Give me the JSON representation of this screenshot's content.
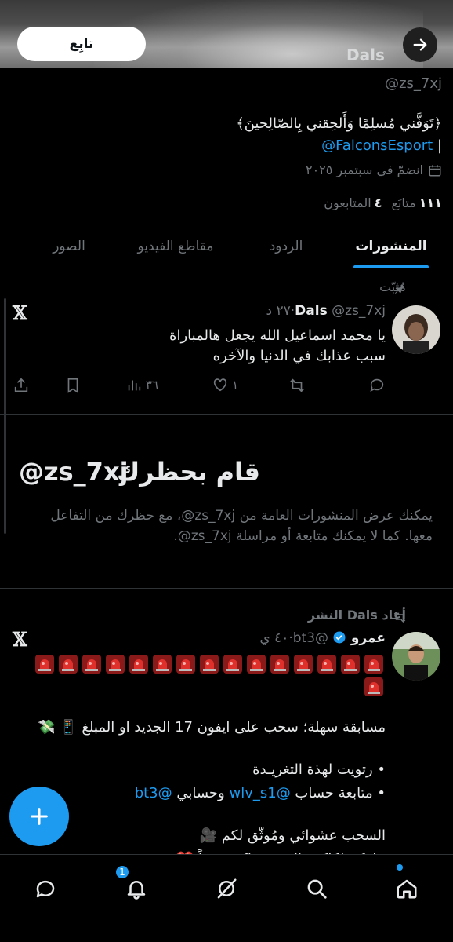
{
  "header": {
    "follow_label": "تابِع",
    "name": "Dals",
    "back_icon": "arrow-right-icon"
  },
  "profile": {
    "handle": "@zs_7xj",
    "bio_line1": "﴿تَوَفَّني مُسلِمًا وَأَلحِقني بِالصّالِحينَ﴾",
    "bio_mention": "@FalconsEsport",
    "bio_sep": "|",
    "joined": "انضمّ في سبتمبر ٢٠٢٥",
    "following_count": "١١١",
    "following_label": "متابَع",
    "followers_count": "٤",
    "followers_label": "المتابعون"
  },
  "tabs": [
    {
      "label": "المنشورات",
      "active": true
    },
    {
      "label": "الردود",
      "active": false
    },
    {
      "label": "مقاطع الفيديو",
      "active": false
    },
    {
      "label": "الصور",
      "active": false
    }
  ],
  "pinned_tweet": {
    "pinned_label": "مُثبّت",
    "author_name": "Dals",
    "author_handle": "@zs_7xj",
    "dot": "·",
    "time": "٢٧ د",
    "text_line1": "يا محمد اسماعيل الله يجعل هالمباراة",
    "text_line2": "سبب  عذابك في الدنيا والآخره",
    "replies": "",
    "retweets": "",
    "likes": "١",
    "views": "٣٦"
  },
  "blocked": {
    "title": "قام بحظرك",
    "handle": "@zs_7xj",
    "description": "يمكنك عرض المنشورات العامة من zs_7xj@، مع حظرك من التفاعل معها. كما لا يمكنك متابعة أو مراسلة zs_7xj@."
  },
  "retweet": {
    "retweet_label": "أعاد Dals النشر",
    "author_name": "عمرو",
    "author_handle": "@bt3",
    "dot": "·",
    "time": "٤٠ ي",
    "siren_count": 16,
    "line1": "مسابقة سهلة؛ سحب على ايفون 17 الجديد او المبلغ 📱 💸",
    "bullet1": "• رتويت لهذة التغريـدة",
    "bullet2_prefix": "• متابعة حساب ",
    "bullet2_mention1": "@wlv_s1",
    "bullet2_mid": " وحسابي ",
    "bullet2_mention2": "@bt3",
    "line_last": "السحب عشوائي ومُوثّق لكم 🎥",
    "line_cut": "خلوكم لكاكين التغريدة اكبر عدداً ❤️"
  },
  "bottom_nav": {
    "items": [
      "home-icon",
      "search-icon",
      "grok-icon",
      "notifications-icon",
      "messages-icon"
    ],
    "notif_badge": "1"
  },
  "colors": {
    "accent": "#1d9bf0",
    "background": "#000000",
    "muted": "#71767b"
  }
}
